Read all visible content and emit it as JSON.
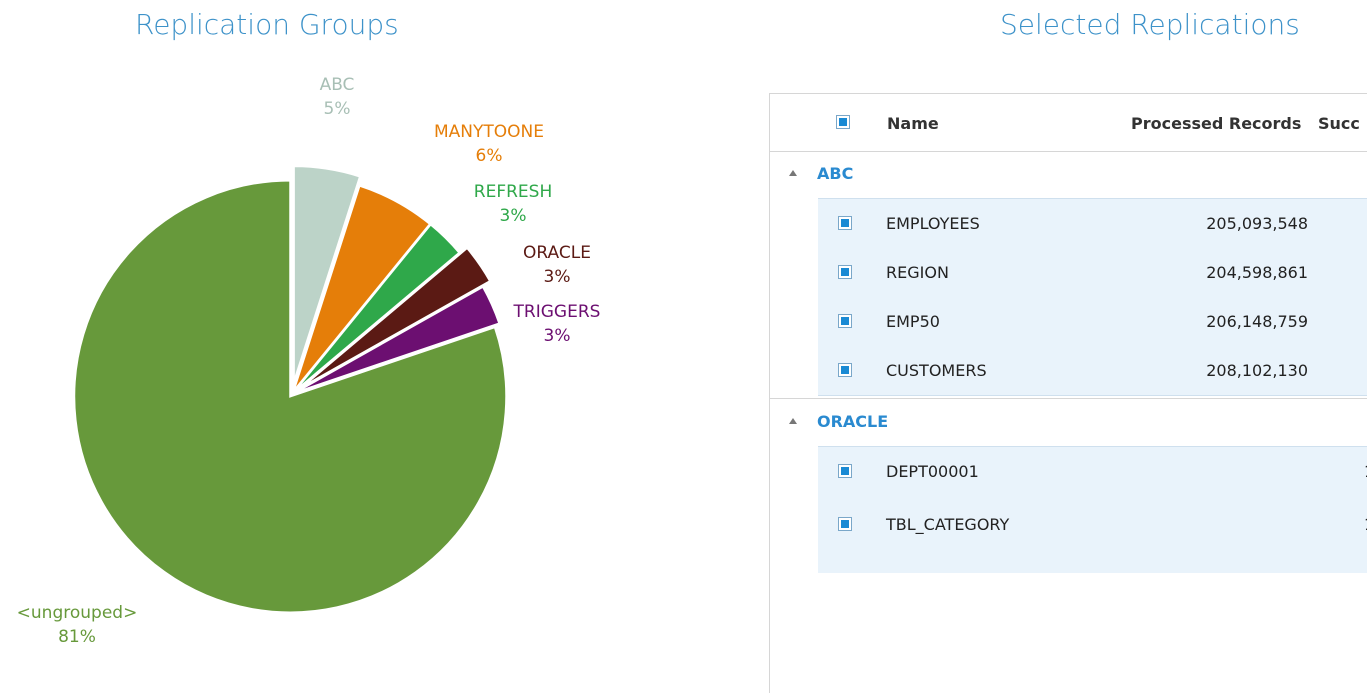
{
  "left_panel": {
    "title": "Replication Groups"
  },
  "right_panel": {
    "title": "Selected Replications"
  },
  "chart_data": {
    "type": "pie",
    "title": "Replication Groups",
    "slices": [
      {
        "name": "ABC",
        "percent": 5,
        "color": "#bcd3c8",
        "label_color": "#a8bfb5",
        "exploded": true
      },
      {
        "name": "MANYTOONE",
        "percent": 6,
        "color": "#e57e09",
        "label_color": "#e57e09",
        "exploded": false
      },
      {
        "name": "REFRESH",
        "percent": 3,
        "color": "#2fa84a",
        "label_color": "#2fa84a",
        "exploded": false
      },
      {
        "name": "ORACLE",
        "percent": 3,
        "color": "#5b1a14",
        "label_color": "#5b1a14",
        "exploded": true
      },
      {
        "name": "TRIGGERS",
        "percent": 3,
        "color": "#6c0f71",
        "label_color": "#6c0f71",
        "exploded": false
      },
      {
        "name": "<ungrouped>",
        "percent": 81,
        "color": "#67993b",
        "label_color": "#67993b",
        "exploded": false
      }
    ]
  },
  "table": {
    "columns": [
      "Name",
      "Processed Records",
      "Succ"
    ],
    "groups": [
      {
        "name": "ABC",
        "rows": [
          {
            "name": "EMPLOYEES",
            "processed": "205,093,548"
          },
          {
            "name": "REGION",
            "processed": "204,598,861"
          },
          {
            "name": "EMP50",
            "processed": "206,148,759"
          },
          {
            "name": "CUSTOMERS",
            "processed": "208,102,130"
          }
        ]
      },
      {
        "name": "ORACLE",
        "rows": [
          {
            "name": "DEPT00001",
            "processed": "",
            "trunc": "1"
          },
          {
            "name": "TBL_CATEGORY",
            "processed": "",
            "trunc": "1"
          }
        ]
      }
    ]
  }
}
